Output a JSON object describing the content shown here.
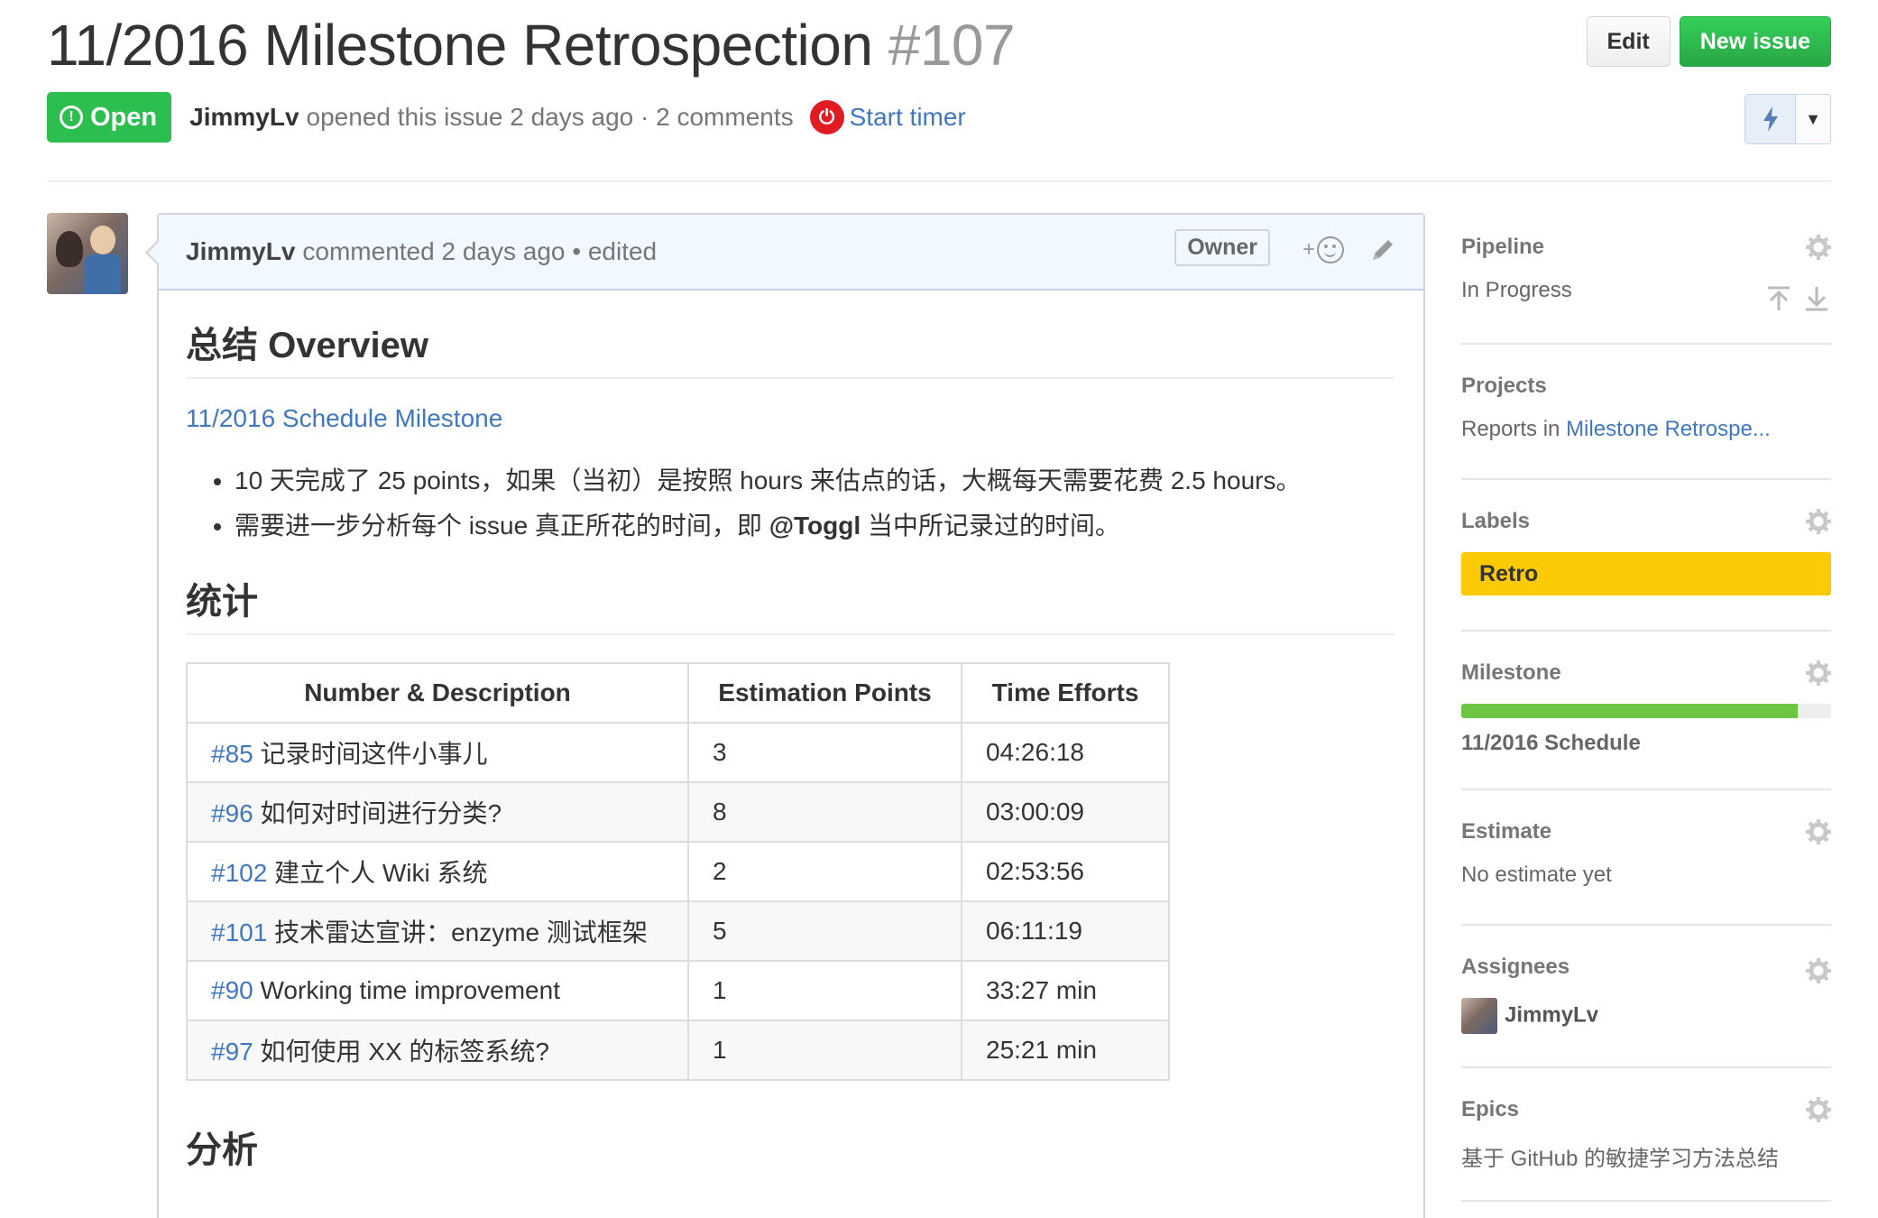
{
  "issue": {
    "title": "11/2016 Milestone Retrospection",
    "number": "#107",
    "state": "Open",
    "author": "JimmyLv",
    "opened_text": "opened this issue 2 days ago · 2 comments",
    "start_timer": "Start timer"
  },
  "header": {
    "edit_label": "Edit",
    "new_issue_label": "New issue"
  },
  "comment": {
    "author": "JimmyLv",
    "meta": "commented 2 days ago • edited",
    "owner_badge": "Owner",
    "reaction_plus": "+",
    "h_overview": "总结 Overview",
    "milestone_link": "11/2016 Schedule Milestone",
    "bullet1": "10 天完成了 25 points，如果（当初）是按照 hours 来估点的话，大概每天需要花费 2.5 hours。",
    "bullet2_pre": "需要进一步分析每个 issue 真正所花的时间，即 ",
    "bullet2_bold": "@Toggl",
    "bullet2_post": " 当中所记录过的时间。",
    "h_stats": "统计",
    "h_analysis": "分析",
    "table": {
      "headers": [
        "Number & Description",
        "Estimation Points",
        "Time Efforts"
      ],
      "rows": [
        {
          "num": "#85",
          "desc": " 记录时间这件小事儿",
          "points": "3",
          "time": "04:26:18"
        },
        {
          "num": "#96",
          "desc": " 如何对时间进行分类?",
          "points": "8",
          "time": "03:00:09"
        },
        {
          "num": "#102",
          "desc": " 建立个人 Wiki 系统",
          "points": "2",
          "time": "02:53:56"
        },
        {
          "num": "#101",
          "desc": " 技术雷达宣讲：enzyme 测试框架",
          "points": "5",
          "time": "06:11:19"
        },
        {
          "num": "#90",
          "desc": " Working time improvement",
          "points": "1",
          "time": "33:27 min"
        },
        {
          "num": "#97",
          "desc": " 如何使用 XX 的标签系统?",
          "points": "1",
          "time": "25:21 min"
        }
      ]
    }
  },
  "sidebar": {
    "pipeline_label": "Pipeline",
    "pipeline_value": "In Progress",
    "projects_label": "Projects",
    "projects_prefix": "Reports in ",
    "projects_link": "Milestone Retrospe...",
    "labels_label": "Labels",
    "label_retro": "Retro",
    "milestone_label": "Milestone",
    "milestone_progress": 0.91,
    "milestone_name": "11/2016 Schedule",
    "estimate_label": "Estimate",
    "estimate_value": "No estimate yet",
    "assignees_label": "Assignees",
    "assignee": "JimmyLv",
    "epics_label": "Epics",
    "epics_value": "基于 GitHub 的敏捷学习方法总结"
  },
  "colors": {
    "open_green": "#2cbe4e",
    "link_blue": "#4078c0",
    "retro_yellow": "#fbca04",
    "progress_green": "#6cc644"
  }
}
